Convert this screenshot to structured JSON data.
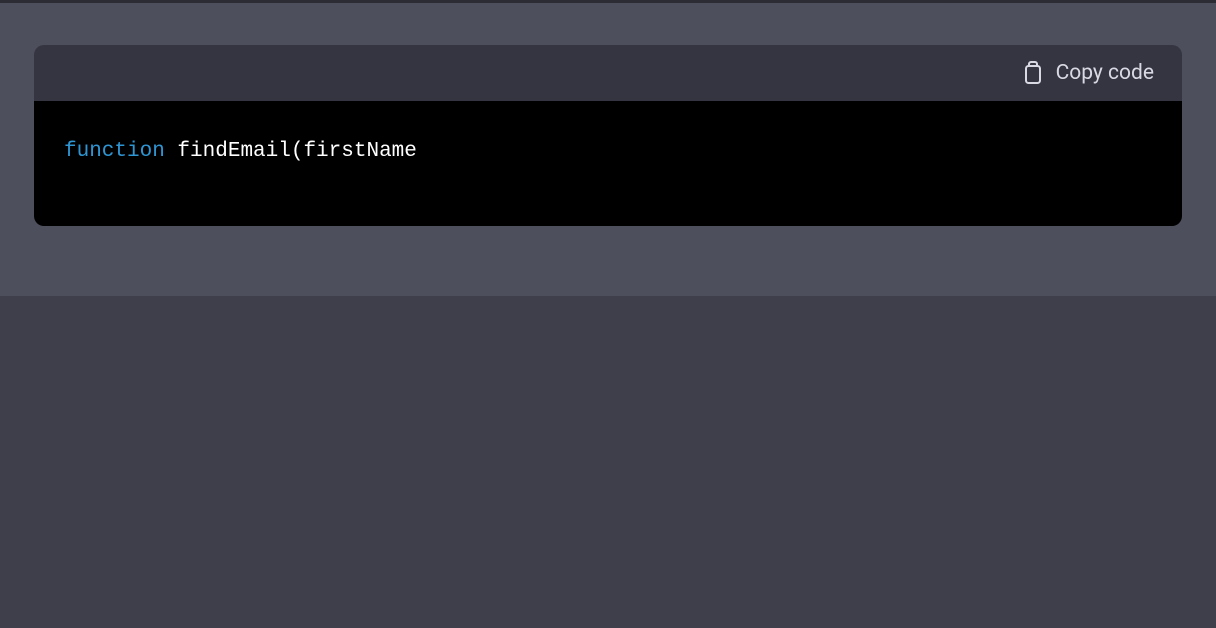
{
  "codeBlock": {
    "copyLabel": "Copy code",
    "tokens": [
      {
        "type": "keyword",
        "text": "function"
      },
      {
        "type": "default",
        "text": " findEmail(firstName"
      }
    ]
  }
}
